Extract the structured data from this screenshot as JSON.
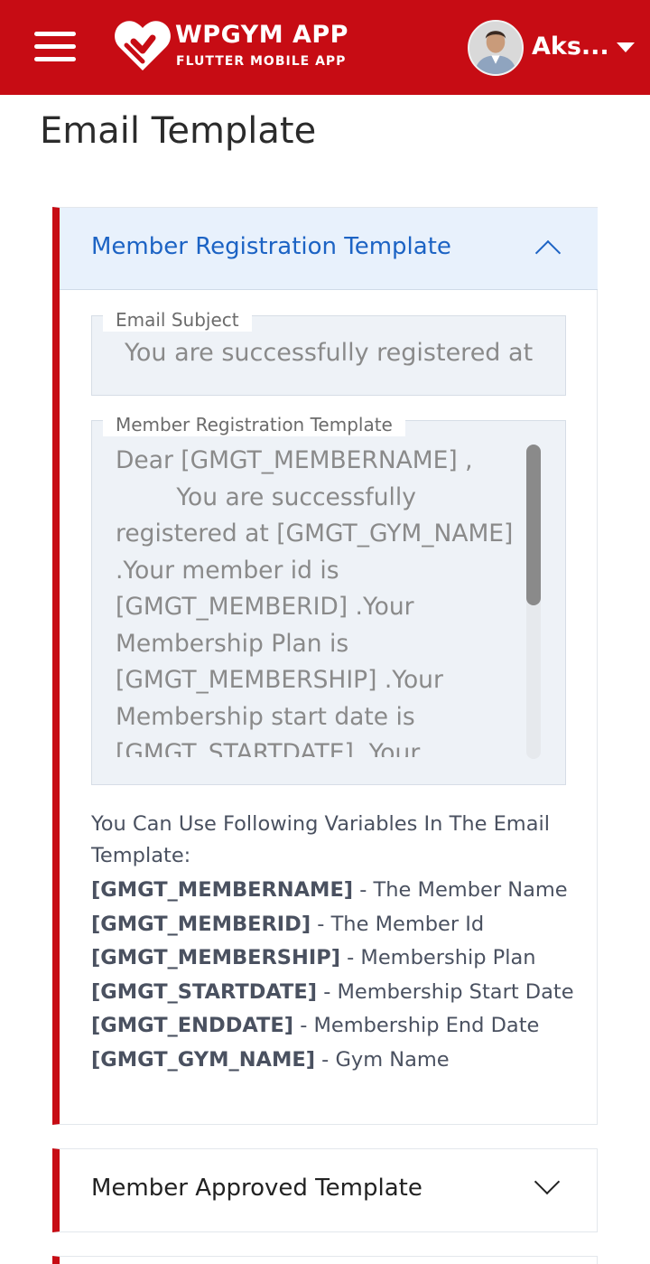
{
  "app": {
    "title": "WPGYM APP",
    "subtitle": "FLUTTER MOBILE APP",
    "user_name": "Aks...",
    "brand_color": "#c70c14",
    "accent_color": "#1c63c4"
  },
  "page": {
    "title": "Email Template"
  },
  "templates": [
    {
      "title": "Member Registration Template",
      "expanded": true,
      "subject_label": "Email Subject",
      "subject_value": "You are successfully registered at",
      "body_label": "Member Registration Template",
      "body_value": "Dear [GMGT_MEMBERNAME] ,\n        You are successfully registered at [GMGT_GYM_NAME] .Your member id is [GMGT_MEMBERID] .Your  Membership Plan is [GMGT_MEMBERSHIP] .Your Membership start date is [GMGT_STARTDATE] .Your",
      "variables_intro": "You Can Use Following Variables In The Email Template:",
      "variables": [
        {
          "key": "[GMGT_MEMBERNAME]",
          "desc": " - The Member Name"
        },
        {
          "key": "[GMGT_MEMBERID]",
          "desc": " - The Member Id"
        },
        {
          "key": "[GMGT_MEMBERSHIP]",
          "desc": " - Membership Plan"
        },
        {
          "key": "[GMGT_STARTDATE]",
          "desc": " - Membership Start Date"
        },
        {
          "key": "[GMGT_ENDDATE]",
          "desc": " - Membership End Date"
        },
        {
          "key": "[GMGT_GYM_NAME]",
          "desc": " - Gym Name"
        }
      ]
    },
    {
      "title": "Member Approved Template",
      "expanded": false
    }
  ],
  "icons": {
    "menu": "hamburger-menu-icon",
    "logo": "heart-logo-icon",
    "dropdown": "caret-down-icon",
    "collapse": "chevron-up-icon",
    "expand": "chevron-down-icon"
  }
}
